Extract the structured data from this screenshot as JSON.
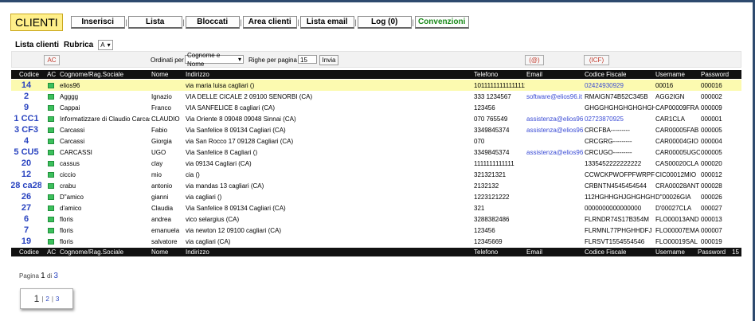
{
  "nav": {
    "brand": "CLIENTI",
    "items": [
      {
        "label": "Inserisci",
        "color": "#000"
      },
      {
        "label": "Lista",
        "color": "#000"
      },
      {
        "label": "Bloccati",
        "color": "#000"
      },
      {
        "label": "Area clienti",
        "color": "#000"
      },
      {
        "label": "Lista email",
        "color": "#000"
      },
      {
        "label": "Log (0)",
        "color": "#000"
      },
      {
        "label": "Convenzioni",
        "color": "#1a8a1a"
      }
    ],
    "separator": "|"
  },
  "section": {
    "title": "Lista clienti",
    "rubrica_label": "Rubrica",
    "rubrica_value": "A"
  },
  "controls": {
    "ac_button": "AC",
    "order_label": "Ordinati per",
    "order_value": "Cognome e Nome",
    "rows_label": "Righe per pagina",
    "rows_value": "15",
    "send_button": "Invia",
    "at_button": "(@)",
    "icf_button": "(ICF)"
  },
  "table": {
    "headers": [
      "Codice",
      "AC",
      "Cognome/Rag.Sociale",
      "Nome",
      "Indirizzo",
      "Telefono",
      "Email",
      "Codice Fiscale",
      "Username",
      "Password"
    ],
    "footer_count": "15",
    "rows": [
      {
        "codice": "14",
        "cognome": "elios96",
        "nome": "",
        "indirizzo": "via maria luisa cagliari ()",
        "telefono": "10111111111111111",
        "email": "",
        "cf": "02424930929",
        "username": "00016",
        "password": "000016",
        "selected": true,
        "cf_link": true
      },
      {
        "codice": "2",
        "cognome": "Agggg",
        "nome": "Ignazio",
        "indirizzo": "VIA DELLE CICALE 2 09100 SENORBI (CA)",
        "telefono": "333 1234567",
        "email": "software@elios96.it",
        "cf": "RMAIGN74B52C345B",
        "username": "AGG2IGN",
        "password": "000002"
      },
      {
        "codice": "9",
        "cognome": "Cappai",
        "nome": "Franco",
        "indirizzo": "VIA SANFELICE 8 cagliari (CA)",
        "telefono": "123456",
        "email": "",
        "cf": "GHGGHGHGHGHGHGHG",
        "username": "CAP00009FRA",
        "password": "000009"
      },
      {
        "codice": "1 CC1",
        "cognome": "Informatizzare di Claudio Carcassi",
        "nome": "CLAUDIO",
        "indirizzo": "Via Oriente 8 09048 09048 Sinnai (CA)",
        "telefono": "070 765549",
        "email": "assistenza@elios96.it",
        "cf": "02723870925",
        "username": "CAR1CLA",
        "password": "000001",
        "cf_link": true
      },
      {
        "codice": "3 CF3",
        "cognome": "Carcassi",
        "nome": "Fabio",
        "indirizzo": "Via Sanfelice 8 09134 Cagliari (CA)",
        "telefono": "3349845374",
        "email": "assistenza@elios96.it",
        "cf": "CRCFBA---------",
        "username": "CAR00005FAB",
        "password": "000005"
      },
      {
        "codice": "4",
        "cognome": "Carcassi",
        "nome": "Giorgia",
        "indirizzo": "via San Rocco 17 09128 Cagliari (CA)",
        "telefono": "070",
        "email": "",
        "cf": "CRCGRG---------",
        "username": "CAR00004GIO",
        "password": "000004"
      },
      {
        "codice": "5 CU5",
        "cognome": "CARCASSI",
        "nome": "UGO",
        "indirizzo": "Via Sanfelice 8 Cagliari ()",
        "telefono": "3349845374",
        "email": "assistenza@elios96.it",
        "cf": "CRCUGO---------",
        "username": "CAR00005UGO",
        "password": "000005"
      },
      {
        "codice": "20",
        "cognome": "cassus",
        "nome": "clay",
        "indirizzo": "via 09134 Cagliari (CA)",
        "telefono": "1111111111111",
        "email": "",
        "cf": "1335452222222222",
        "username": "CAS00020CLA",
        "password": "000020"
      },
      {
        "codice": "12",
        "cognome": "ciccio",
        "nome": "mio",
        "indirizzo": "cia ()",
        "telefono": "321321321",
        "email": "",
        "cf": "CCWCKPWOFPFWRPFE",
        "username": "CIC00012MIO",
        "password": "000012"
      },
      {
        "codice": "28 ca28",
        "cognome": "crabu",
        "nome": "antonio",
        "indirizzo": "via mandas 13 cagliari (CA)",
        "telefono": "2132132",
        "email": "",
        "cf": "CRBNTN4545454544",
        "username": "CRA00028ANT",
        "password": "000028"
      },
      {
        "codice": "26",
        "cognome": "D\"amico",
        "nome": "gianni",
        "indirizzo": "via cagliari ()",
        "telefono": "1223121222",
        "email": "",
        "cf": "112HGHHGHJGHGHGH",
        "username": "D\"00026GIA",
        "password": "000026"
      },
      {
        "codice": "27",
        "cognome": "d'amico",
        "nome": "Claudia",
        "indirizzo": "Via Sanfelice 8 09134 Cagliari (CA)",
        "telefono": "321",
        "email": "",
        "cf": "0000000000000000",
        "username": "D'00027CLA",
        "password": "000027"
      },
      {
        "codice": "6",
        "cognome": "floris",
        "nome": "andrea",
        "indirizzo": "vico selargius (CA)",
        "telefono": "3288382486",
        "email": "",
        "cf": "FLRNDR74S17B354M",
        "username": "FLO00013AND",
        "password": "000013"
      },
      {
        "codice": "7",
        "cognome": "floris",
        "nome": "emanuela",
        "indirizzo": "via newton 12 09100 cagliari (CA)",
        "telefono": "123456",
        "email": "",
        "cf": "FLRMNL77PHGHHDFJ",
        "username": "FLO00007EMA",
        "password": "000007"
      },
      {
        "codice": "19",
        "cognome": "floris",
        "nome": "salvatore",
        "indirizzo": "via cagliari (CA)",
        "telefono": "12345669",
        "email": "",
        "cf": "FLRSVT1554554546",
        "username": "FLO00019SAL",
        "password": "000019"
      }
    ]
  },
  "pagination": {
    "label": "Pagina",
    "current": "1",
    "of": "di",
    "total": "3",
    "pages": [
      "1",
      "2",
      "3"
    ]
  }
}
